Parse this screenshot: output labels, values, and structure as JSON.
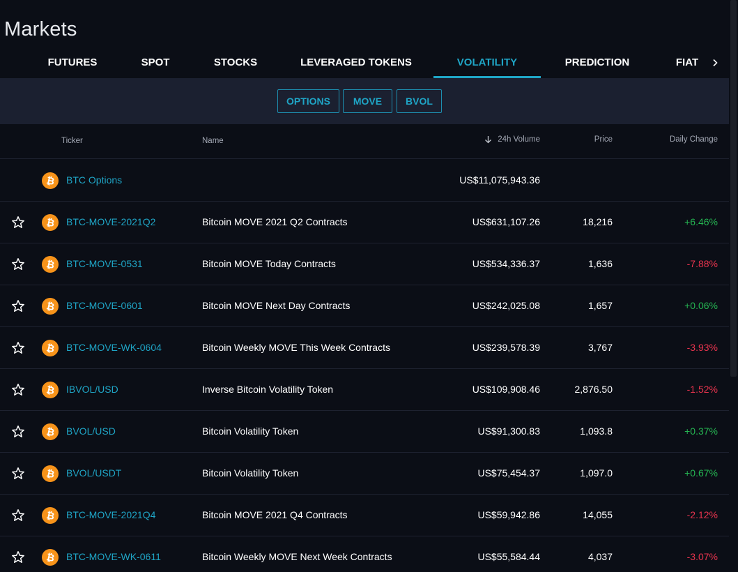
{
  "page": {
    "title": "Markets"
  },
  "colors": {
    "accent": "#1fa5c6",
    "positive": "#25b552",
    "negative": "#e8344e",
    "bitcoin": "#f7931a",
    "background": "#0b0e16",
    "subbar": "#1b2030"
  },
  "tabs": [
    {
      "label": "FUTURES",
      "active": false
    },
    {
      "label": "SPOT",
      "active": false
    },
    {
      "label": "STOCKS",
      "active": false
    },
    {
      "label": "LEVERAGED TOKENS",
      "active": false
    },
    {
      "label": "VOLATILITY",
      "active": true
    },
    {
      "label": "PREDICTION",
      "active": false
    },
    {
      "label": "FIAT",
      "active": false
    }
  ],
  "tab_more_icon": "chevron-right-icon",
  "subtabs": [
    {
      "label": "OPTIONS"
    },
    {
      "label": "MOVE"
    },
    {
      "label": "BVOL"
    }
  ],
  "table": {
    "columns": {
      "ticker": "Ticker",
      "name": "Name",
      "volume": "24h Volume",
      "price": "Price",
      "change": "Daily Change"
    },
    "sort_icon": "arrow-down-icon",
    "rows": [
      {
        "ticker": "BTC Options",
        "name": "",
        "volume": "US$11,075,943.36",
        "price": "",
        "change": "",
        "direction": "",
        "favorite": false
      },
      {
        "ticker": "BTC-MOVE-2021Q2",
        "name": "Bitcoin MOVE 2021 Q2 Contracts",
        "volume": "US$631,107.26",
        "price": "18,216",
        "change": "+6.46%",
        "direction": "up",
        "favorite": true
      },
      {
        "ticker": "BTC-MOVE-0531",
        "name": "Bitcoin MOVE Today Contracts",
        "volume": "US$534,336.37",
        "price": "1,636",
        "change": "-7.88%",
        "direction": "down",
        "favorite": true
      },
      {
        "ticker": "BTC-MOVE-0601",
        "name": "Bitcoin MOVE Next Day Contracts",
        "volume": "US$242,025.08",
        "price": "1,657",
        "change": "+0.06%",
        "direction": "up",
        "favorite": true
      },
      {
        "ticker": "BTC-MOVE-WK-0604",
        "name": "Bitcoin Weekly MOVE This Week Contracts",
        "volume": "US$239,578.39",
        "price": "3,767",
        "change": "-3.93%",
        "direction": "down",
        "favorite": true
      },
      {
        "ticker": "IBVOL/USD",
        "name": "Inverse Bitcoin Volatility Token",
        "volume": "US$109,908.46",
        "price": "2,876.50",
        "change": "-1.52%",
        "direction": "down",
        "favorite": true
      },
      {
        "ticker": "BVOL/USD",
        "name": "Bitcoin Volatility Token",
        "volume": "US$91,300.83",
        "price": "1,093.8",
        "change": "+0.37%",
        "direction": "up",
        "favorite": true
      },
      {
        "ticker": "BVOL/USDT",
        "name": "Bitcoin Volatility Token",
        "volume": "US$75,454.37",
        "price": "1,097.0",
        "change": "+0.67%",
        "direction": "up",
        "favorite": true
      },
      {
        "ticker": "BTC-MOVE-2021Q4",
        "name": "Bitcoin MOVE 2021 Q4 Contracts",
        "volume": "US$59,942.86",
        "price": "14,055",
        "change": "-2.12%",
        "direction": "down",
        "favorite": true
      },
      {
        "ticker": "BTC-MOVE-WK-0611",
        "name": "Bitcoin Weekly MOVE Next Week Contracts",
        "volume": "US$55,584.44",
        "price": "4,037",
        "change": "-3.07%",
        "direction": "down",
        "favorite": true
      }
    ]
  }
}
